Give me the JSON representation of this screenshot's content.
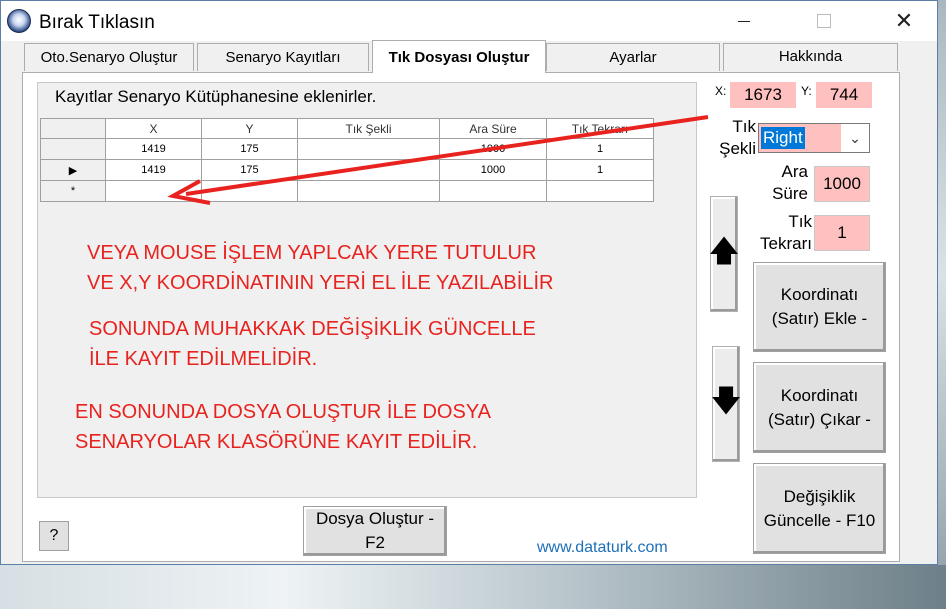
{
  "window": {
    "title": "Bırak Tıklasın",
    "controls": {
      "minimize": "",
      "maximize": "",
      "close": "✕"
    }
  },
  "tabs": [
    {
      "label": "Oto.Senaryo Oluştur",
      "active": false
    },
    {
      "label": "Senaryo Kayıtları",
      "active": false
    },
    {
      "label": "Tık Dosyası Oluştur",
      "active": true
    },
    {
      "label": "Ayarlar",
      "active": false
    },
    {
      "label": "Hakkında",
      "active": false
    }
  ],
  "panel": {
    "info_label": "Kayıtlar Senaryo Kütüphanesine eklenirler."
  },
  "grid": {
    "columns": [
      "X",
      "Y",
      "Tık Şekli",
      "Ara Süre",
      "Tık Tekrarı"
    ],
    "rows": [
      {
        "indicator": "",
        "cells": [
          "1419",
          "175",
          "",
          "1000",
          "1"
        ]
      },
      {
        "indicator": "▶",
        "cells": [
          "1419",
          "175",
          "",
          "1000",
          "1"
        ]
      },
      {
        "indicator": "*",
        "cells": [
          "",
          "",
          "",
          "",
          ""
        ]
      }
    ]
  },
  "coords": {
    "x_label": "X:",
    "x_value": "1673",
    "y_label": "Y:",
    "y_value": "744"
  },
  "fields": {
    "tik_sekli_label": "Tık\nŞekli",
    "tik_sekli_value": "Right",
    "ara_sure_label": "Ara\nSüre",
    "ara_sure_value": "1000",
    "tik_tekrari_label": "Tık\nTekrarı",
    "tik_tekrari_value": "1"
  },
  "buttons": {
    "add_row": "Koordinatı\n(Satır) Ekle -",
    "remove_row": "Koordinatı\n(Satır) Çıkar -",
    "update": "Değişiklik\nGüncelle - F10",
    "create_file": "Dosya Oluştur -\nF2",
    "help": "?"
  },
  "link": "www.dataturk.com",
  "annotations": [
    "VEYA MOUSE İŞLEM YAPLCAK YERE TUTULUR\nVE X,Y KOORDİNATININ YERİ EL İLE YAZILABİLİR",
    "SONUNDA MUHAKKAK DEĞİŞİKLİK GÜNCELLE\nİLE KAYIT EDİLMELİDİR.",
    "EN SONUNDA DOSYA OLUŞTUR İLE DOSYA\nSENARYOLAR KLASÖRÜNE KAYIT EDİLİR."
  ],
  "colors": {
    "annotation": "#e8231f",
    "field_bg": "#ffc0c0",
    "link": "#1e6fb8",
    "selection": "#0078d7"
  }
}
